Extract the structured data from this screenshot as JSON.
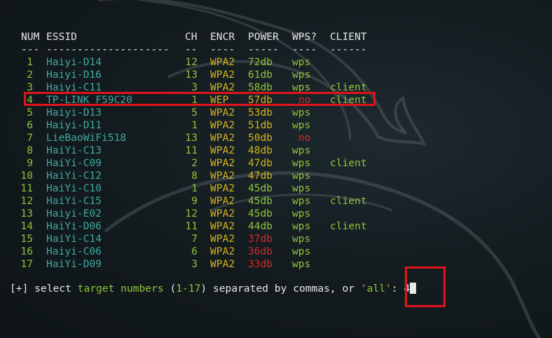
{
  "headers": {
    "num": "NUM",
    "essid": "ESSID",
    "ch": "CH",
    "encr": "ENCR",
    "power": "POWER",
    "wps": "WPS?",
    "client": "CLIENT"
  },
  "separators": {
    "num": "---",
    "essid": "--------------------",
    "ch": "--",
    "encr": "----",
    "power": "-----",
    "wps": "----",
    "client": "------"
  },
  "rows": [
    {
      "num": "1",
      "essid": "Haiyi-D14",
      "ch": "12",
      "encr": "WPA2",
      "power": "72db",
      "wps": "wps",
      "client": ""
    },
    {
      "num": "2",
      "essid": "Haiyi-D16",
      "ch": "13",
      "encr": "WPA2",
      "power": "61db",
      "wps": "wps",
      "client": ""
    },
    {
      "num": "3",
      "essid": "Haiyi-C11",
      "ch": "3",
      "encr": "WPA2",
      "power": "58db",
      "wps": "wps",
      "client": "client"
    },
    {
      "num": "4",
      "essid": "TP-LINK F59C20",
      "ch": "1",
      "encr": "WEP",
      "power": "57db",
      "wps": "no",
      "client": "client"
    },
    {
      "num": "5",
      "essid": "Haiyi-D13",
      "ch": "5",
      "encr": "WPA2",
      "power": "53db",
      "wps": "wps",
      "client": ""
    },
    {
      "num": "6",
      "essid": "Haiyi-D11",
      "ch": "1",
      "encr": "WPA2",
      "power": "51db",
      "wps": "wps",
      "client": ""
    },
    {
      "num": "7",
      "essid": "LieBaoWiFi518",
      "ch": "13",
      "encr": "WPA2",
      "power": "50db",
      "wps": "no",
      "client": ""
    },
    {
      "num": "8",
      "essid": "HaiYi-C13",
      "ch": "11",
      "encr": "WPA2",
      "power": "48db",
      "wps": "wps",
      "client": ""
    },
    {
      "num": "9",
      "essid": "HaiYi-C09",
      "ch": "2",
      "encr": "WPA2",
      "power": "47db",
      "wps": "wps",
      "client": "client"
    },
    {
      "num": "10",
      "essid": "HaiYi-C12",
      "ch": "8",
      "encr": "WPA2",
      "power": "47db",
      "wps": "wps",
      "client": ""
    },
    {
      "num": "11",
      "essid": "HaiYi-C10",
      "ch": "1",
      "encr": "WPA2",
      "power": "45db",
      "wps": "wps",
      "client": ""
    },
    {
      "num": "12",
      "essid": "HaiYi-C15",
      "ch": "9",
      "encr": "WPA2",
      "power": "45db",
      "wps": "wps",
      "client": "client"
    },
    {
      "num": "13",
      "essid": "Haiyi-E02",
      "ch": "12",
      "encr": "WPA2",
      "power": "45db",
      "wps": "wps",
      "client": ""
    },
    {
      "num": "14",
      "essid": "HaiYi-D06",
      "ch": "11",
      "encr": "WPA2",
      "power": "44db",
      "wps": "wps",
      "client": "client"
    },
    {
      "num": "15",
      "essid": "HaiYi-C14",
      "ch": "7",
      "encr": "WPA2",
      "power": "37db",
      "wps": "wps",
      "client": ""
    },
    {
      "num": "16",
      "essid": "Haiyi-C06",
      "ch": "6",
      "encr": "WPA2",
      "power": "36db",
      "wps": "wps",
      "client": ""
    },
    {
      "num": "17",
      "essid": "HaiYi-D09",
      "ch": "3",
      "encr": "WPA2",
      "power": "33db",
      "wps": "wps",
      "client": ""
    }
  ],
  "prompt": {
    "prefix": "[+]",
    "text1": " select ",
    "target": "target numbers",
    "open_paren": " (",
    "range": "1-17",
    "text2": ") separated by commas, or ",
    "quote_open": "'",
    "all": "all",
    "quote_close": "'",
    "colon": ": ",
    "input_value": "4"
  },
  "colors": {
    "green": "#8fc43a",
    "teal": "#3fa9a0",
    "yellow": "#d3b41a",
    "red": "#d22b2b",
    "highlight": "#e0141c"
  }
}
